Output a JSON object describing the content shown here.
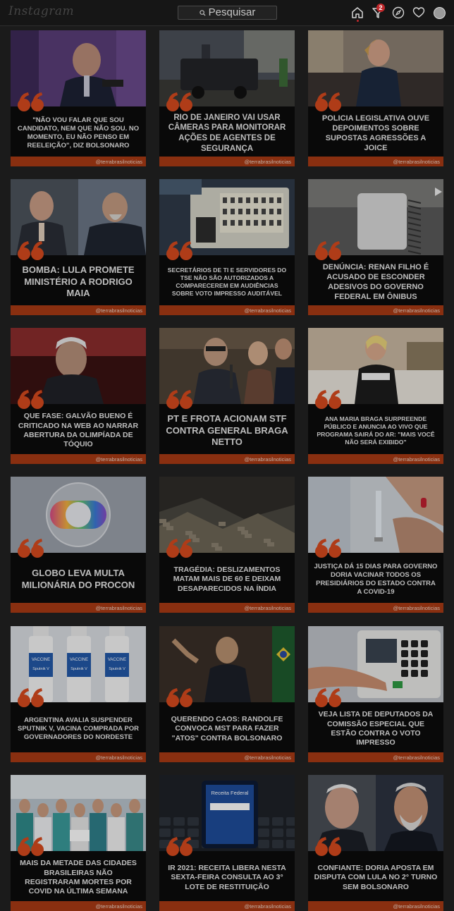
{
  "app": {
    "logo": "Instagram",
    "search_placeholder": "Pesquisar",
    "notifications_count": "2"
  },
  "nav_icons": [
    "home-icon",
    "activity-icon",
    "explore-icon",
    "heart-icon",
    "profile-avatar"
  ],
  "colors": {
    "accent_orange": "#a83a14",
    "quote_orange": "#d64a1e",
    "background": "#1b1b1b"
  },
  "posts": [
    {
      "headline": "\"NÃO VOU FALAR QUE SOU CANDIDATO, NEM QUE NÃO SOU. NO MOMENTO, EU NÃO PENSO EM REELEIÇÃO\", DIZ BOLSONARO",
      "handle": "@terrabrasilnoticias",
      "image": "politician-speaking-purple-background"
    },
    {
      "headline": "RIO DE JANEIRO VAI USAR CÂMERAS PARA MONITORAR AÇÕES DE AGENTES DE SEGURANÇA",
      "handle": "@terrabrasilnoticias",
      "image": "armored-police-vehicle-street"
    },
    {
      "headline": "POLICIA LEGISLATIVA OUVE DEPOIMENTOS SOBRE SUPOSTAS AGRESSÕES A JOICE",
      "handle": "@terrabrasilnoticias",
      "image": "woman-seated-in-room"
    },
    {
      "headline": "BOMBA: LULA PROMETE MINISTÉRIO A RODRIGO MAIA",
      "handle": "@terrabrasilnoticias",
      "image": "two-politicians-split"
    },
    {
      "headline": "SECRETÁRIOS DE TI E SERVIDORES DO TSE NÃO SÃO AUTORIZADOS A COMPARECEREM EM AUDIÊNCIAS SOBRE VOTO IMPRESSO AUDITÁVEL",
      "handle": "@terrabrasilnoticias",
      "image": "electronic-voting-machine"
    },
    {
      "headline": "DENÚNCIA: RENAN FILHO É ACUSADO DE ESCONDER ADESIVOS DO GOVERNO FEDERAL EM ÔNIBUS",
      "handle": "@terrabrasilnoticias",
      "image": "bus-interior-video"
    },
    {
      "headline": "QUE FASE: GALVÃO BUENO É CRITICADO NA WEB AO NARRAR ABERTURA DA OLIMPÍADA DE TÓQUIO",
      "handle": "@terrabrasilnoticias",
      "image": "sports-commentator-stadium"
    },
    {
      "headline": "PT E FROTA ACIONAM STF CONTRA GENERAL BRAGA NETTO",
      "handle": "@terrabrasilnoticias",
      "image": "congress-session-speaker"
    },
    {
      "headline": "ANA MARIA BRAGA SURPREENDE PÚBLICO E ANUNCIA AO VIVO QUE PROGRAMA SAIRÁ DO AR: \"MAIS VOCÊ NÃO SERÁ EXIBIDO\"",
      "handle": "@terrabrasilnoticias",
      "image": "tv-host-studio"
    },
    {
      "headline": "GLOBO LEVA MULTA MILIONÁRIA DO PROCON",
      "handle": "@terrabrasilnoticias",
      "image": "globo-logo"
    },
    {
      "headline": "TRAGÉDIA: DESLIZAMENTOS MATAM MAIS DE 60 E DEIXAM DESAPARECIDOS NA ÍNDIA",
      "handle": "@terrabrasilnoticias",
      "image": "landslide-debris"
    },
    {
      "headline": "JUSTIÇA DÁ 15 DIAS PARA GOVERNO DORIA VACINAR TODOS OS PRESIDIÁRIOS DO ESTADO CONTRA A COVID-19",
      "handle": "@terrabrasilnoticias",
      "image": "vaccine-syringe-hands"
    },
    {
      "headline": "ARGENTINA AVALIA SUSPENDER SPUTNIK V, VACINA COMPRADA POR GOVERNADORES DO NORDESTE",
      "handle": "@terrabrasilnoticias",
      "image": "sputnik-vaccine-vials",
      "vial_label": "VACCINE",
      "vial_brand": "Sputnik V"
    },
    {
      "headline": "QUERENDO CAOS: RANDOLFE CONVOCA MST PARA FAZER \"ATOS\" CONTRA BOLSONARO",
      "handle": "@terrabrasilnoticias",
      "image": "senator-speaking-flag"
    },
    {
      "headline": "VEJA LISTA DE DEPUTADOS DA COMISSÃO ESPECIAL QUE ESTÃO CONTRA O VOTO IMPRESSO",
      "handle": "@terrabrasilnoticias",
      "image": "voting-machine-keypad"
    },
    {
      "headline": "MAIS DA METADE DAS CIDADES BRASILEIRAS NÃO REGISTRARAM MORTES POR COVID NA ÚLTIMA SEMANA",
      "handle": "@terrabrasilnoticias",
      "image": "health-workers-group"
    },
    {
      "headline": "IR 2021: RECEITA LIBERA NESTA SEXTA-FEIRA CONSULTA AO 3° LOTE DE RESTITUIÇÃO",
      "handle": "@terrabrasilnoticias",
      "image": "phone-receita-federal",
      "phone_text": "Receita Federal"
    },
    {
      "headline": "CONFIANTE: DORIA APOSTA EM DISPUTA COM LULA NO 2° TURNO SEM BOLSONARO",
      "handle": "@terrabrasilnoticias",
      "image": "two-politicians-faces"
    }
  ]
}
